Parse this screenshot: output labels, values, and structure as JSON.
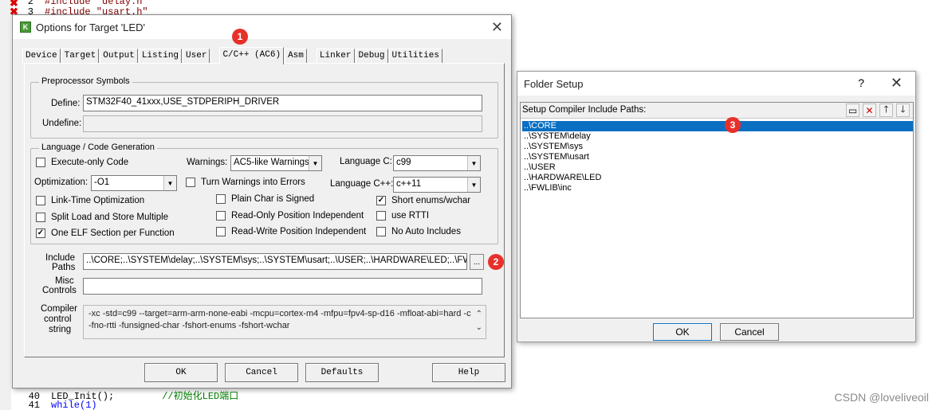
{
  "editor": {
    "lines_top": [
      {
        "num": "2",
        "text": "#include \"delay.h\""
      },
      {
        "num": "3",
        "text": "#include \"usart.h\""
      }
    ],
    "lines_bottom": [
      {
        "num": "40",
        "code": "LED_Init();",
        "comment": "//初始化LED端口"
      },
      {
        "num": "41",
        "code": "while(1)",
        "comment": ""
      }
    ],
    "watermark": "CSDN @loveliveoil"
  },
  "options_dialog": {
    "title": "Options for Target 'LED'",
    "tabs": [
      "Device",
      "Target",
      "Output",
      "Listing",
      "User",
      "C/C++ (AC6)",
      "Asm",
      "Linker",
      "Debug",
      "Utilities"
    ],
    "active_tab": "C/C++ (AC6)",
    "preprocessor": {
      "group_title": "Preprocessor Symbols",
      "define_label": "Define:",
      "define_value": "STM32F40_41xxx,USE_STDPERIPH_DRIVER",
      "undefine_label": "Undefine:",
      "undefine_value": ""
    },
    "language": {
      "group_title": "Language / Code Generation",
      "execute_only": {
        "label": "Execute-only Code",
        "checked": false
      },
      "optimization_label": "Optimization:",
      "optimization_value": "-O1",
      "link_time": {
        "label": "Link-Time Optimization",
        "checked": false
      },
      "split_load": {
        "label": "Split Load and Store Multiple",
        "checked": false
      },
      "one_elf": {
        "label": "One ELF Section per Function",
        "checked": true
      },
      "warnings_label": "Warnings:",
      "warnings_value": "AC5-like Warnings",
      "turn_warnings": {
        "label": "Turn Warnings into Errors",
        "checked": false
      },
      "plain_char": {
        "label": "Plain Char is Signed",
        "checked": false
      },
      "ro_pos": {
        "label": "Read-Only Position Independent",
        "checked": false
      },
      "rw_pos": {
        "label": "Read-Write Position Independent",
        "checked": false
      },
      "lang_c_label": "Language C:",
      "lang_c_value": "c99",
      "lang_cpp_label": "Language C++:",
      "lang_cpp_value": "c++11",
      "short_enums": {
        "label": "Short enums/wchar",
        "checked": true
      },
      "use_rtti": {
        "label": "use RTTI",
        "checked": false
      },
      "no_auto_includes": {
        "label": "No Auto Includes",
        "checked": false
      }
    },
    "include_paths": {
      "label_1": "Include",
      "label_2": "Paths",
      "value": "..\\CORE;..\\SYSTEM\\delay;..\\SYSTEM\\sys;..\\SYSTEM\\usart;..\\USER;..\\HARDWARE\\LED;..\\FWL",
      "browse": "..."
    },
    "misc_controls": {
      "label_1": "Misc",
      "label_2": "Controls",
      "value": ""
    },
    "compiler_control": {
      "label_1": "Compiler",
      "label_2": "control",
      "label_3": "string",
      "line_1": "-xc -std=c99 --target=arm-arm-none-eabi -mcpu=cortex-m4 -mfpu=fpv4-sp-d16 -mfloat-abi=hard -c",
      "line_2": "-fno-rtti -funsigned-char -fshort-enums -fshort-wchar"
    },
    "buttons": {
      "ok": "OK",
      "cancel": "Cancel",
      "defaults": "Defaults",
      "help": "Help"
    }
  },
  "folder_setup": {
    "title": "Folder Setup",
    "help": "?",
    "header": "Setup Compiler Include Paths:",
    "paths": [
      "..\\CORE",
      "..\\SYSTEM\\delay",
      "..\\SYSTEM\\sys",
      "..\\SYSTEM\\usart",
      "..\\USER",
      "..\\HARDWARE\\LED",
      "..\\FWLIB\\inc"
    ],
    "selected_index": 0,
    "ok": "OK",
    "cancel": "Cancel"
  },
  "annotations": {
    "b1": "1",
    "b2": "2",
    "b3": "3"
  },
  "colors": {
    "selection": "#0a6fc2",
    "badge": "#e8302b",
    "dialog_bg": "#f0f0f0"
  }
}
